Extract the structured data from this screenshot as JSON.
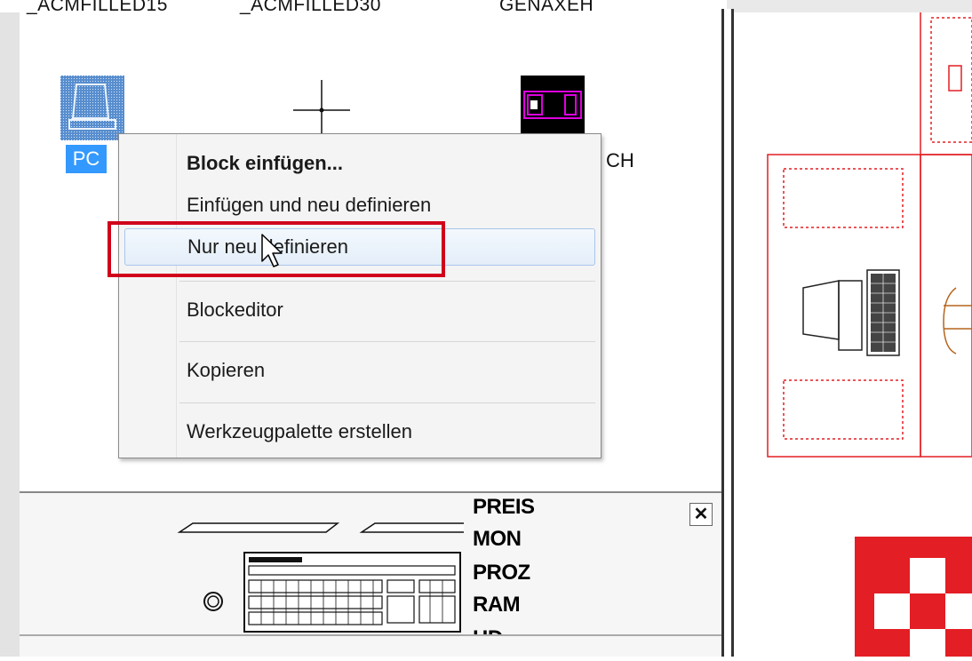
{
  "block_library": {
    "labels": [
      "_ACMFILLED15",
      "_ACMFILLED30",
      "GENAXEH"
    ],
    "selected_block": "PC",
    "partial_label": "CH"
  },
  "context_menu": {
    "items": [
      {
        "label": "Block einfügen...",
        "bold": true
      },
      {
        "label": "Einfügen und neu definieren"
      },
      {
        "label": "Nur neu definieren",
        "hover": true
      },
      {
        "label": "Blockeditor"
      },
      {
        "label": "Kopieren"
      },
      {
        "label": "Werkzeugpalette erstellen"
      }
    ]
  },
  "preview": {
    "close_symbol": "✕",
    "attributes": [
      "PREIS",
      "MON",
      "PROZ",
      "RAM",
      "HD"
    ]
  },
  "colors": {
    "highlight": "#d0021b",
    "selection": "#3399ff",
    "drawing_lines": "#e31e24"
  },
  "icons": [
    "pc-block-icon",
    "crosshair-block-icon",
    "genaxeh-block-icon",
    "mouse-pointer-icon",
    "close-icon",
    "keyboard-drawing",
    "monitor-drawing"
  ]
}
